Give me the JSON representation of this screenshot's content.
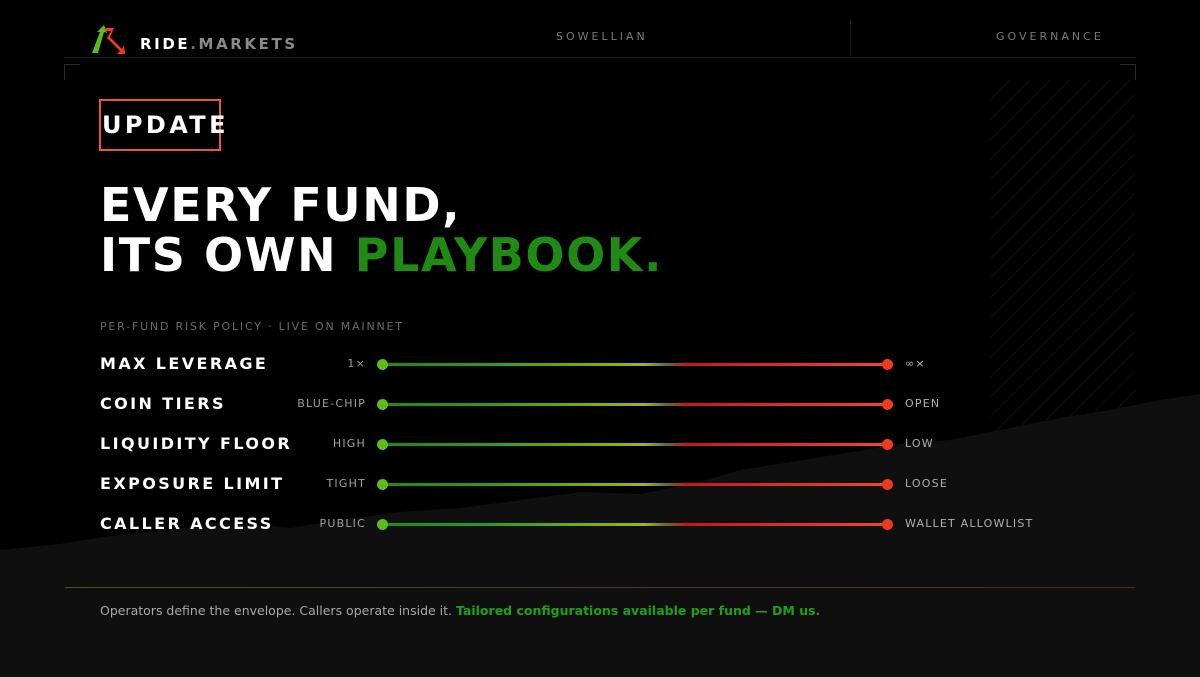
{
  "brand": {
    "name_primary": "RIDE",
    "separator": ".",
    "name_secondary": "MARKETS"
  },
  "nav": {
    "items": [
      {
        "label": "SOWELLIAN"
      },
      {
        "label": "GOVERNANCE"
      }
    ]
  },
  "badge": {
    "label": "UPDATE"
  },
  "headline": {
    "line1": "EVERY FUND,",
    "line2_prefix": "ITS OWN ",
    "line2_accent": "PLAYBOOK."
  },
  "kicker": "PER-FUND RISK POLICY · LIVE ON MAINNET",
  "policies": [
    {
      "name": "MAX LEVERAGE",
      "low": "1×",
      "high": "∞×"
    },
    {
      "name": "COIN TIERS",
      "low": "BLUE-CHIP",
      "high": "OPEN"
    },
    {
      "name": "LIQUIDITY FLOOR",
      "low": "HIGH",
      "high": "LOW"
    },
    {
      "name": "EXPOSURE LIMIT",
      "low": "TIGHT",
      "high": "LOOSE"
    },
    {
      "name": "CALLER ACCESS",
      "low": "PUBLIC",
      "high": "WALLET ALLOWLIST"
    }
  ],
  "footer": {
    "text": "Operators define the envelope. Callers operate inside it.",
    "cta": "Tailored configurations available per fund — DM us."
  },
  "colors": {
    "accent_green": "#1f8a14",
    "badge_border": "#e85a2a",
    "knob_low": "#5dbb1c",
    "knob_high": "#ef3a1f",
    "background": "#000000"
  },
  "icons": {
    "logo": "ride-markets-logo-icon"
  }
}
